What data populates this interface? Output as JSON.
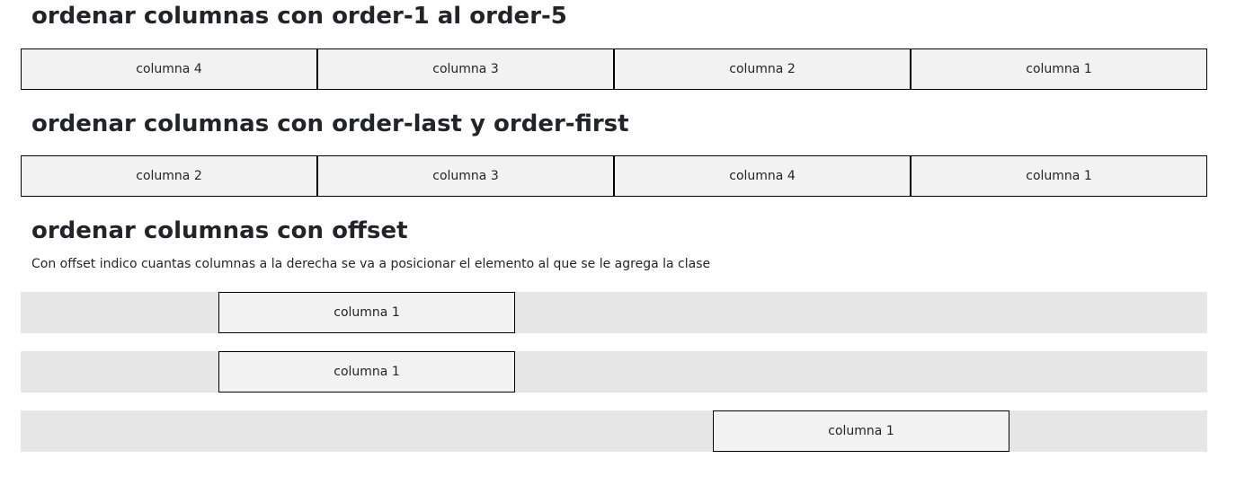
{
  "section_order": {
    "title": "ordenar columnas con order-1 al order-5",
    "columns": [
      "columna 4",
      "columna 3",
      "columna 2",
      "columna 1"
    ]
  },
  "section_first_last": {
    "title": "ordenar columnas con order-last y order-first",
    "columns": [
      "columna 2",
      "columna 3",
      "columna 4",
      "columna 1"
    ]
  },
  "section_offset": {
    "title": "ordenar columnas con offset",
    "description": "Con offset indico cuantas columnas a la derecha se va a posicionar el elemento al que se le agrega la clase",
    "rows": [
      {
        "label": "columna 1"
      },
      {
        "label": "columna 1"
      },
      {
        "label": "columna 1"
      }
    ]
  }
}
